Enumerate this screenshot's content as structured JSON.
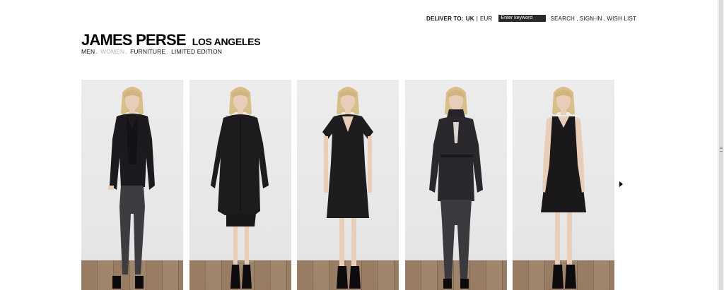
{
  "utility": {
    "deliver_label": "DELIVER TO:",
    "country": "UK",
    "separator": "|",
    "currency": "EUR",
    "search_placeholder": "Enter keyword",
    "links": [
      "SEARCH",
      "SIGN-IN",
      "WISH LIST"
    ]
  },
  "logo": {
    "brand": "JAMES PERSE",
    "city": "LOS ANGELES"
  },
  "categories": [
    {
      "label": "MEN",
      "active": false
    },
    {
      "label": "WOMEN",
      "active": true
    },
    {
      "label": "FURNITURE",
      "active": false
    },
    {
      "label": "LIMITED EDITION",
      "active": false
    }
  ],
  "category_separator": ".",
  "lookbook": {
    "items": [
      {
        "alt": "black hooded cardigan with dark trousers",
        "outfit": "cardigan-pants"
      },
      {
        "alt": "long black utility coat with skirt",
        "outfit": "long-coat"
      },
      {
        "alt": "black wrap dress",
        "outfit": "wrap-dress"
      },
      {
        "alt": "black cinched jacket with trousers",
        "outfit": "trench-pants"
      },
      {
        "alt": "black sleeveless shift dress",
        "outfit": "shift-dress"
      }
    ],
    "next_icon": "chevron-right-icon"
  },
  "colors": {
    "background": "#ffffff",
    "text": "#111111",
    "muted": "#b5b5b5",
    "search_bg": "#2a2a2a"
  }
}
